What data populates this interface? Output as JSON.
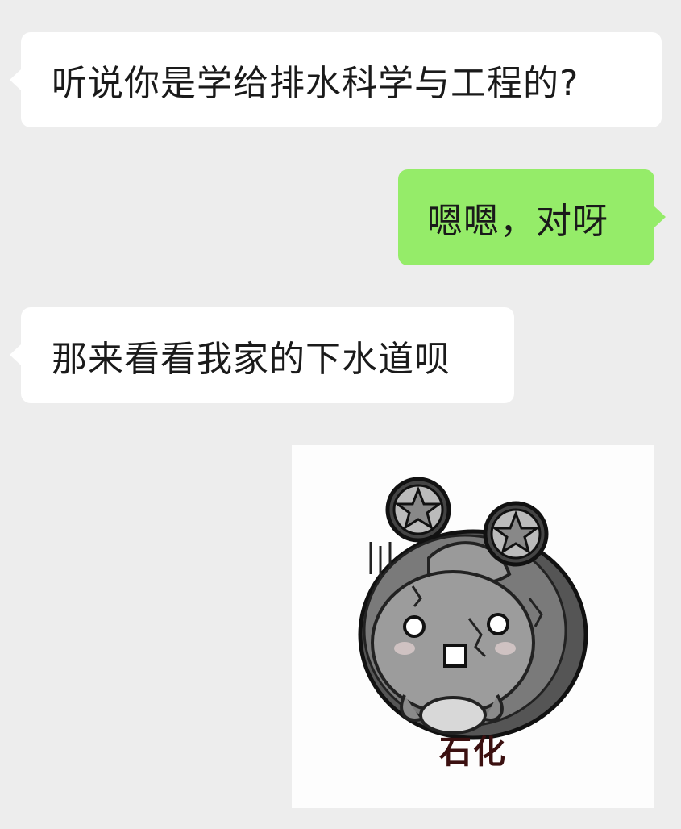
{
  "chat": {
    "messages": [
      {
        "side": "incoming",
        "text": "听说你是学给排水科学与工程的?"
      },
      {
        "side": "outgoing",
        "text": "嗯嗯，对呀"
      },
      {
        "side": "incoming",
        "text": "那来看看我家的下水道呗"
      },
      {
        "side": "outgoing",
        "type": "sticker",
        "sticker_icon": "petrified-cartoon-sticker",
        "caption": "石化"
      }
    ]
  },
  "colors": {
    "background": "#ededed",
    "incoming_bubble": "#ffffff",
    "outgoing_bubble": "#95ec69",
    "sticker_caption": "#3b1010"
  }
}
